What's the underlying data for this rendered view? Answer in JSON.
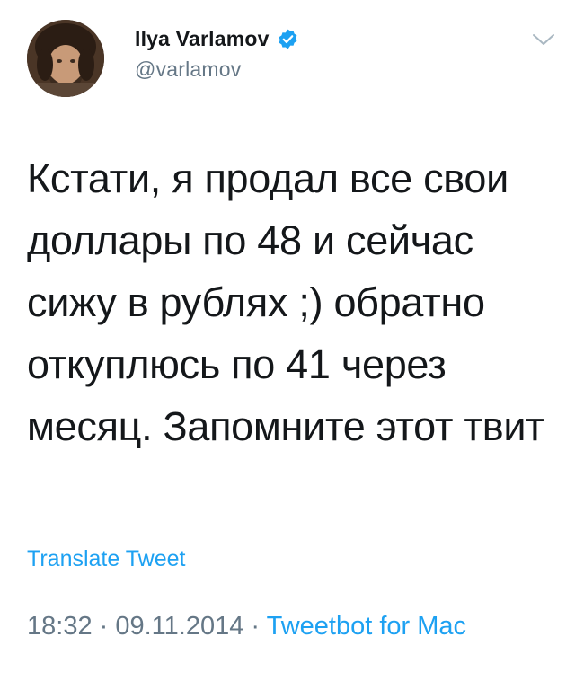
{
  "tweet": {
    "author": {
      "display_name": "Ilya Varlamov",
      "handle": "@varlamov",
      "verified": true
    },
    "text": "Кстати, я продал все свои доллары по 48 и сейчас сижу в рублях ;) обратно откуплюсь по 41 через месяц. Запомните этот твит",
    "translate_label": "Translate Tweet",
    "time": "18:32",
    "date": "09.11.2014",
    "separator": " · ",
    "source": "Tweetbot for Mac"
  },
  "icons": {
    "avatar": "user-avatar",
    "verified": "verified-badge-icon",
    "menu": "chevron-down-icon"
  },
  "colors": {
    "accent": "#1da1f2",
    "text": "#14171a",
    "secondary": "#657786"
  }
}
